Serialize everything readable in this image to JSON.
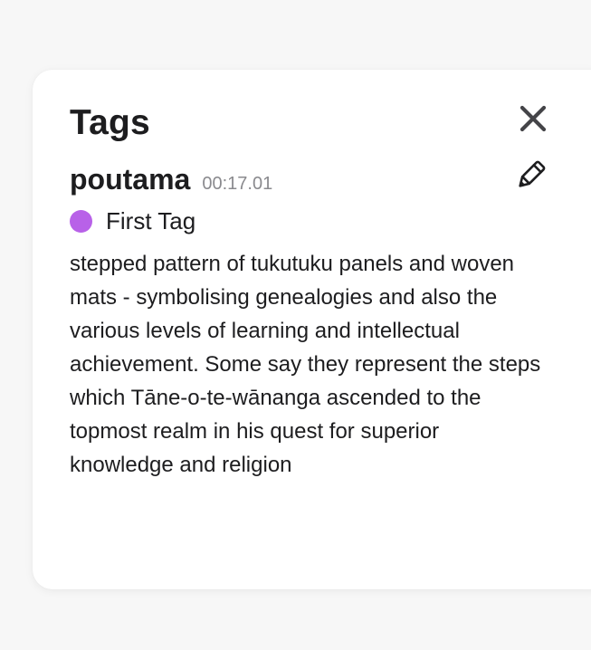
{
  "panel": {
    "title": "Tags",
    "close_icon": "close-icon",
    "edit_icon": "pencil-icon"
  },
  "tag": {
    "name": "poutama",
    "timestamp": "00:17.01",
    "label": "First Tag",
    "label_color": "#b861e8",
    "description": "stepped pattern of tukutuku panels and woven mats - symbolising genealogies and also the various levels of learning and intellectual achievement. Some say they represent the steps which Tāne-o-te-wānanga ascended to the topmost realm in his quest for superior knowledge and religion"
  },
  "colors": {
    "page_background": "#f7f7f7",
    "card_background": "#ffffff",
    "text": "#1d1d1f",
    "muted_text": "#8a8a8e"
  }
}
